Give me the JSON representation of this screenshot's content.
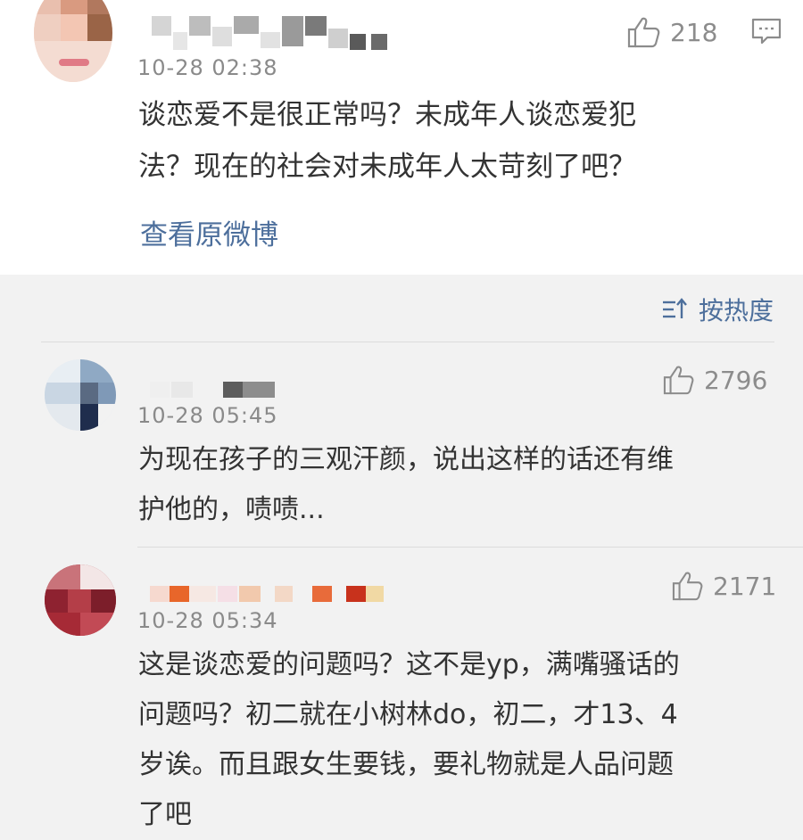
{
  "post": {
    "time": "10-28 02:38",
    "likes": "218",
    "text_line1": "谈恋爱不是很正常吗？未成年人谈恋爱犯",
    "text_line2": "法？现在的社会对未成年人太苛刻了吧？",
    "view_original": "查看原微博"
  },
  "sort": {
    "label": "按热度"
  },
  "comments": [
    {
      "time": "10-28 05:45",
      "likes": "2796",
      "lines": [
        "为现在孩子的三观汗颜，说出这样的话还有维",
        "护他的，啧啧..."
      ]
    },
    {
      "time": "10-28 05:34",
      "likes": "2171",
      "lines": [
        "这是谈恋爱的问题吗？这不是yp，满嘴骚话的",
        "问题吗？初二就在小树林do，初二，才13、4",
        "岁诶。而且跟女生要钱，要礼物就是人品问题",
        "了吧"
      ]
    }
  ],
  "colors": {
    "link": "#4d6f9c",
    "meta": "#8a8a8a",
    "bg": "#f2f2f2"
  }
}
